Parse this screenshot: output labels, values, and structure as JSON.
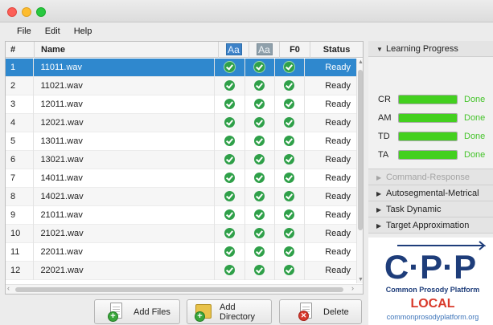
{
  "window": {
    "traffic_lights": [
      "close",
      "minimize",
      "zoom"
    ]
  },
  "menu": [
    "File",
    "Edit",
    "Help"
  ],
  "table": {
    "columns": {
      "num": "#",
      "name": "Name",
      "aa1": "Aa",
      "aa2": "Aa",
      "f0": "F0",
      "status": "Status"
    },
    "rows": [
      {
        "num": "1",
        "name": "11011.wav",
        "status": "Ready"
      },
      {
        "num": "2",
        "name": "11021.wav",
        "status": "Ready"
      },
      {
        "num": "3",
        "name": "12011.wav",
        "status": "Ready"
      },
      {
        "num": "4",
        "name": "12021.wav",
        "status": "Ready"
      },
      {
        "num": "5",
        "name": "13011.wav",
        "status": "Ready"
      },
      {
        "num": "6",
        "name": "13021.wav",
        "status": "Ready"
      },
      {
        "num": "7",
        "name": "14011.wav",
        "status": "Ready"
      },
      {
        "num": "8",
        "name": "14021.wav",
        "status": "Ready"
      },
      {
        "num": "9",
        "name": "21011.wav",
        "status": "Ready"
      },
      {
        "num": "10",
        "name": "21021.wav",
        "status": "Ready"
      },
      {
        "num": "11",
        "name": "22011.wav",
        "status": "Ready"
      },
      {
        "num": "12",
        "name": "22021.wav",
        "status": "Ready"
      }
    ],
    "selected_row": 1
  },
  "buttons": {
    "add_files": "Add Files",
    "add_directory": "Add Directory",
    "delete": "Delete"
  },
  "sidebar": {
    "learning_progress": {
      "title": "Learning Progress",
      "items": [
        {
          "label": "CR",
          "progress": 1.0,
          "status": "Done"
        },
        {
          "label": "AM",
          "progress": 1.0,
          "status": "Done"
        },
        {
          "label": "TD",
          "progress": 1.0,
          "status": "Done"
        },
        {
          "label": "TA",
          "progress": 1.0,
          "status": "Done"
        }
      ]
    },
    "sections": [
      {
        "title": "Command-Response",
        "enabled": false
      },
      {
        "title": "Autosegmental-Metrical",
        "enabled": true
      },
      {
        "title": "Task Dynamic",
        "enabled": true
      },
      {
        "title": "Target Approximation",
        "enabled": true
      }
    ]
  },
  "logo": {
    "mark": "C·P·P",
    "tagline": "Common Prosody Platform",
    "edition": "LOCAL",
    "url": "commonprosodyplatform.org"
  },
  "colors": {
    "selection": "#2f88ce",
    "check": "#2fa049",
    "progress_fill": "#43d01f",
    "done_text": "#46c42c",
    "logo_blue": "#1e3d7a",
    "logo_red": "#d93a2b"
  }
}
